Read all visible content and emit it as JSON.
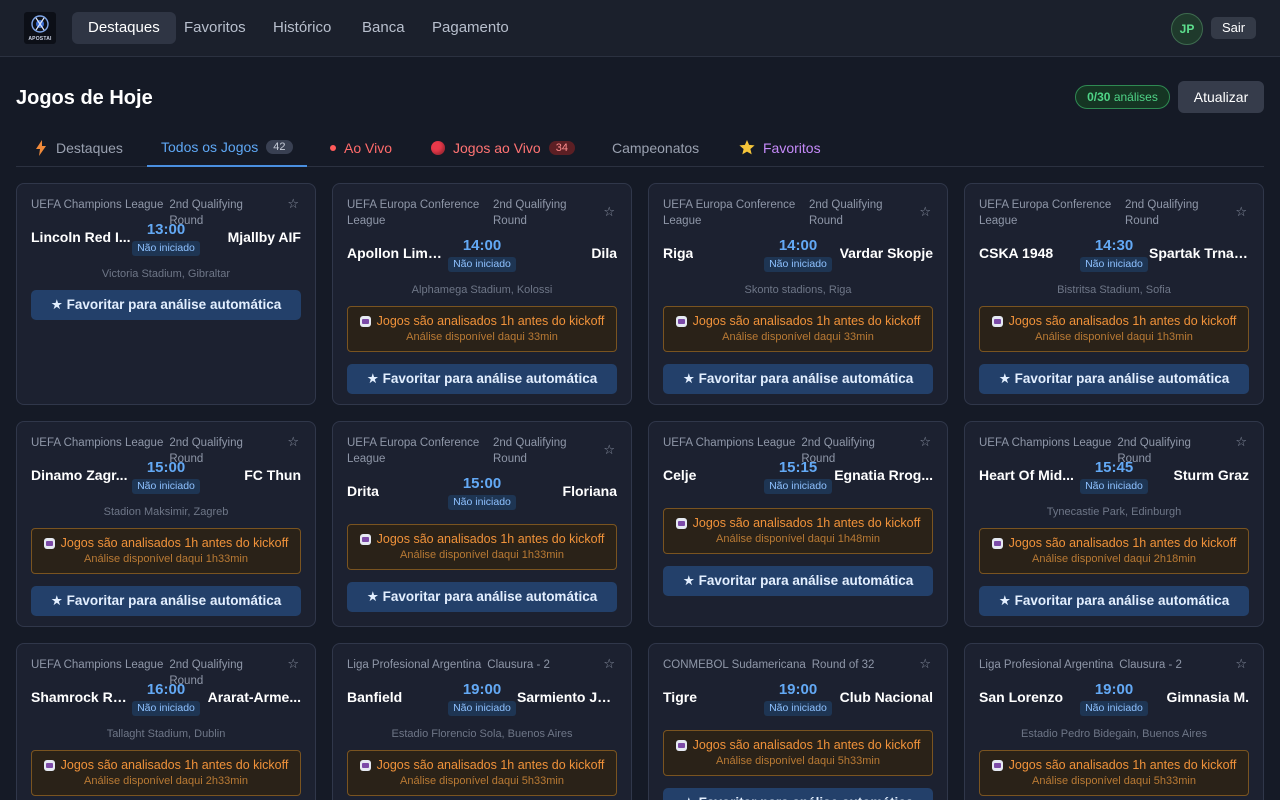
{
  "app": {
    "logo_text": "APOSTAI"
  },
  "nav": {
    "items": [
      {
        "label": "Destaques",
        "active": true
      },
      {
        "label": "Favoritos",
        "active": false
      },
      {
        "label": "Histórico",
        "active": false
      },
      {
        "label": "Banca",
        "active": false
      },
      {
        "label": "Pagamento",
        "active": false
      }
    ],
    "avatar_initials": "JP",
    "logout_label": "Sair"
  },
  "header": {
    "title": "Jogos de Hoje",
    "quota_count": "0/30",
    "quota_suffix": "análises",
    "refresh_label": "Atualizar"
  },
  "tabs": [
    {
      "label": "Destaques",
      "icon": "lightning-icon"
    },
    {
      "label": "Todos os Jogos",
      "badge": "42",
      "active": true
    },
    {
      "label": "Ao Vivo",
      "icon": "live-dot-icon"
    },
    {
      "label": "Jogos ao Vivo",
      "badge": "34",
      "icon": "red-ball-icon"
    },
    {
      "label": "Campeonatos"
    },
    {
      "label": "Favoritos",
      "icon": "star-icon"
    }
  ],
  "colors": {
    "accent": "#5fa8f5",
    "warning": "#f0923a",
    "success": "#4fd487",
    "live": "#ff6b6b"
  },
  "strings": {
    "notice_title": "Jogos são analisados 1h antes do kickoff",
    "fav_button": "★ Favoritar para análise automática"
  },
  "cards": [
    {
      "league": "UEFA Champions League",
      "round": "2nd Qualifying Round",
      "home": "Lincoln Red I...",
      "away": "Mjallby AIF",
      "time": "13:00",
      "status": "Não iniciado",
      "venue": "Victoria Stadium, Gibraltar",
      "notice": false
    },
    {
      "league": "UEFA Europa Conference League",
      "round": "2nd Qualifying Round",
      "home": "Apollon Lima...",
      "away": "Dila",
      "time": "14:00",
      "status": "Não iniciado",
      "venue": "Alphamega Stadium, Kolossi",
      "notice": true,
      "notice_sub": "Análise disponível daqui 33min"
    },
    {
      "league": "UEFA Europa Conference League",
      "round": "2nd Qualifying Round",
      "home": "Riga",
      "away": "Vardar Skopje",
      "time": "14:00",
      "status": "Não iniciado",
      "venue": "Skonto stadions, Riga",
      "notice": true,
      "notice_sub": "Análise disponível daqui 33min"
    },
    {
      "league": "UEFA Europa Conference League",
      "round": "2nd Qualifying Round",
      "home": "CSKA 1948",
      "away": "Spartak Trnava",
      "time": "14:30",
      "status": "Não iniciado",
      "venue": "Bistritsa Stadium, Sofia",
      "notice": true,
      "notice_sub": "Análise disponível daqui 1h3min"
    },
    {
      "league": "UEFA Champions League",
      "round": "2nd Qualifying Round",
      "home": "Dinamo Zagr...",
      "away": "FC Thun",
      "time": "15:00",
      "status": "Não iniciado",
      "venue": "Stadion Maksimir, Zagreb",
      "notice": true,
      "notice_sub": "Análise disponível daqui 1h33min"
    },
    {
      "league": "UEFA Europa Conference League",
      "round": "2nd Qualifying Round",
      "home": "Drita",
      "away": "Floriana",
      "time": "15:00",
      "status": "Não iniciado",
      "venue": "",
      "notice": true,
      "notice_sub": "Análise disponível daqui 1h33min"
    },
    {
      "league": "UEFA Champions League",
      "round": "2nd Qualifying Round",
      "home": "Celje",
      "away": "Egnatia Rrog...",
      "time": "15:15",
      "status": "Não iniciado",
      "venue": "",
      "notice": true,
      "notice_sub": "Análise disponível daqui 1h48min"
    },
    {
      "league": "UEFA Champions League",
      "round": "2nd Qualifying Round",
      "home": "Heart Of Mid...",
      "away": "Sturm Graz",
      "time": "15:45",
      "status": "Não iniciado",
      "venue": "Tynecastie Park, Edinburgh",
      "notice": true,
      "notice_sub": "Análise disponível daqui 2h18min"
    },
    {
      "league": "UEFA Champions League",
      "round": "2nd Qualifying Round",
      "home": "Shamrock Ro...",
      "away": "Ararat-Arme...",
      "time": "16:00",
      "status": "Não iniciado",
      "venue": "Tallaght Stadium, Dublin",
      "notice": true,
      "notice_sub": "Análise disponível daqui 2h33min"
    },
    {
      "league": "Liga Profesional Argentina",
      "round": "Clausura - 2",
      "home": "Banfield",
      "away": "Sarmiento Ju...",
      "time": "19:00",
      "status": "Não iniciado",
      "venue": "Estadio Florencio Sola, Buenos Aires",
      "notice": true,
      "notice_sub": "Análise disponível daqui 5h33min"
    },
    {
      "league": "CONMEBOL Sudamericana",
      "round": "Round of 32",
      "home": "Tigre",
      "away": "Club Nacional",
      "time": "19:00",
      "status": "Não iniciado",
      "venue": "",
      "notice": true,
      "notice_sub": "Análise disponível daqui 5h33min"
    },
    {
      "league": "Liga Profesional Argentina",
      "round": "Clausura - 2",
      "home": "San Lorenzo",
      "away": "Gimnasia M.",
      "time": "19:00",
      "status": "Não iniciado",
      "venue": "Estadio Pedro Bidegain, Buenos Aires",
      "notice": true,
      "notice_sub": "Análise disponível daqui 5h33min"
    }
  ]
}
